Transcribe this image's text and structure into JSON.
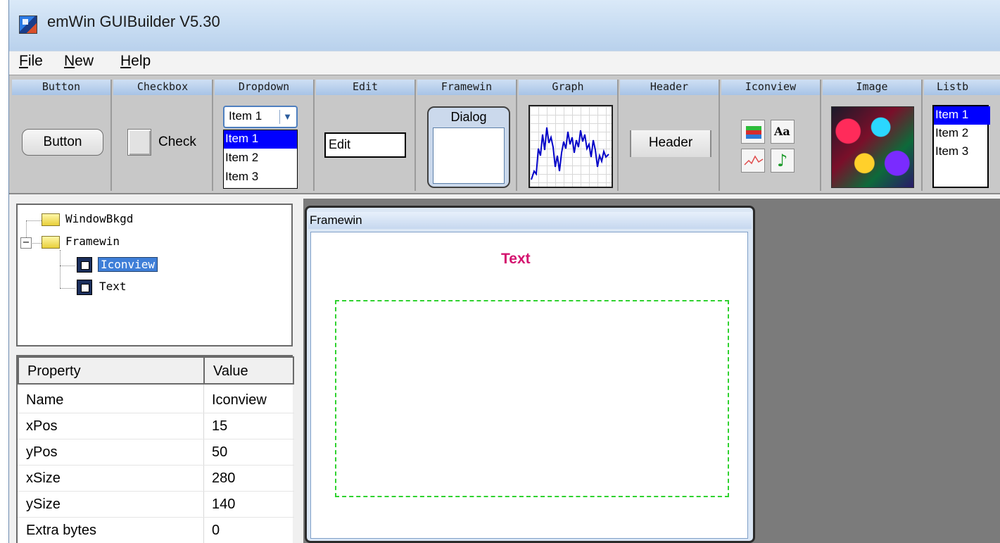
{
  "window": {
    "title": "emWin GUIBuilder V5.30"
  },
  "menu": [
    {
      "label": "File",
      "mnemonic": "F",
      "rest": "ile"
    },
    {
      "label": "New",
      "mnemonic": "N",
      "rest": "ew"
    },
    {
      "label": "Help",
      "mnemonic": "H",
      "rest": "elp"
    }
  ],
  "toolbox": {
    "headers": [
      "Button",
      "Checkbox",
      "Dropdown",
      "Edit",
      "Framewin",
      "Graph",
      "Header",
      "Iconview",
      "Image",
      "Listb"
    ],
    "button_label": "Button",
    "checkbox_label": "Check",
    "dropdown": {
      "selected": "Item 1",
      "items": [
        "Item 1",
        "Item 2",
        "Item 3"
      ],
      "highlighted_index": 0
    },
    "edit_value": "Edit",
    "framewin_label": "Dialog",
    "header_label": "Header",
    "iconview_icons": [
      "books-icon",
      "font-icon",
      "chart-line-icon",
      "music-note-icon"
    ],
    "listbox": {
      "items": [
        "Item 1",
        "Item 2",
        "Item 3"
      ],
      "highlighted_index": 0
    }
  },
  "tree": {
    "nodes": [
      {
        "label": "WindowBkgd",
        "icon": "folder-icon"
      },
      {
        "label": "Framewin",
        "icon": "folder-icon",
        "expanded": true
      },
      {
        "label": "Iconview",
        "icon": "window-icon",
        "selected": true
      },
      {
        "label": "Text",
        "icon": "window-icon"
      }
    ]
  },
  "properties": {
    "headers": {
      "property": "Property",
      "value": "Value"
    },
    "rows": [
      {
        "name": "Name",
        "value": "Iconview"
      },
      {
        "name": "xPos",
        "value": "15"
      },
      {
        "name": "yPos",
        "value": "50"
      },
      {
        "name": "xSize",
        "value": "280"
      },
      {
        "name": "ySize",
        "value": "140"
      },
      {
        "name": "Extra bytes",
        "value": "0"
      }
    ]
  },
  "design": {
    "framewin_title": "Framewin",
    "text_widget": "Text",
    "text_color": "#d4136f",
    "selection_border_color": "#2fd22f"
  },
  "colors": {
    "selection": "#0000ff",
    "canvas_bg": "#7b7b7b",
    "tool_header": "#a7c3e6"
  }
}
